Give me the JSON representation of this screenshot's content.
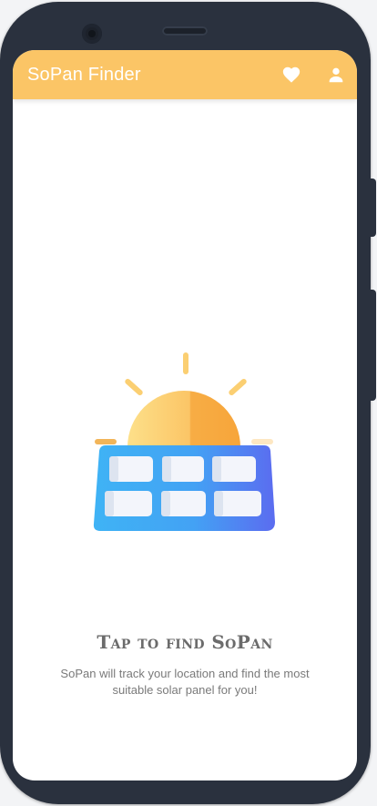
{
  "app_bar": {
    "title": "SoPan Finder",
    "background": "#fbc566",
    "actions": [
      {
        "icon": "heart-icon",
        "color": "#ffffff"
      },
      {
        "icon": "person-icon",
        "color": "#ffffff"
      }
    ]
  },
  "main": {
    "illustration": "solar-panel-icon",
    "headline": "Tap to find SoPan",
    "description": "SoPan will track your location and find the most suitable solar panel for you!"
  },
  "colors": {
    "sun": "#fbc566",
    "panel_start": "#3fb3f5",
    "panel_end": "#5b6cf0",
    "text_muted": "#7a7a7a"
  }
}
